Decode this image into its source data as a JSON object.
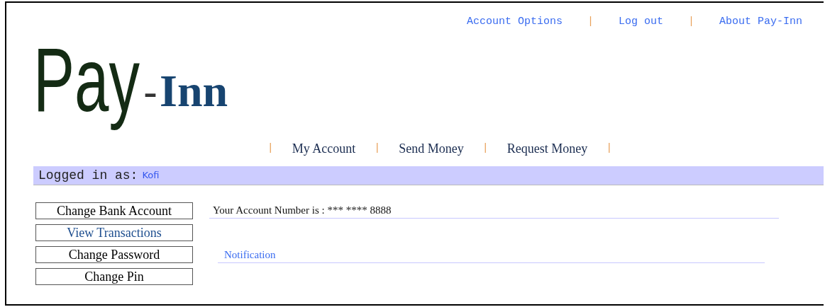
{
  "top_links": [
    "Account Options",
    "Log out",
    "About Pay-Inn"
  ],
  "top_separator": "|",
  "logo": {
    "lead": "Pay",
    "dash": "-",
    "tail": "Inn"
  },
  "nav": {
    "separator": "|",
    "items": [
      "My Account",
      "Send Money",
      "Request Money"
    ]
  },
  "login_bar": {
    "label": "Logged in as:",
    "user": "Kofi"
  },
  "side_buttons": [
    {
      "label": "Change Bank Account",
      "selected": false
    },
    {
      "label": "View Transactions",
      "selected": true
    },
    {
      "label": "Change Password",
      "selected": false
    },
    {
      "label": "Change Pin",
      "selected": false
    }
  ],
  "account_number": "Your Account Number is : *** **** 8888",
  "notification_heading": "Notification"
}
